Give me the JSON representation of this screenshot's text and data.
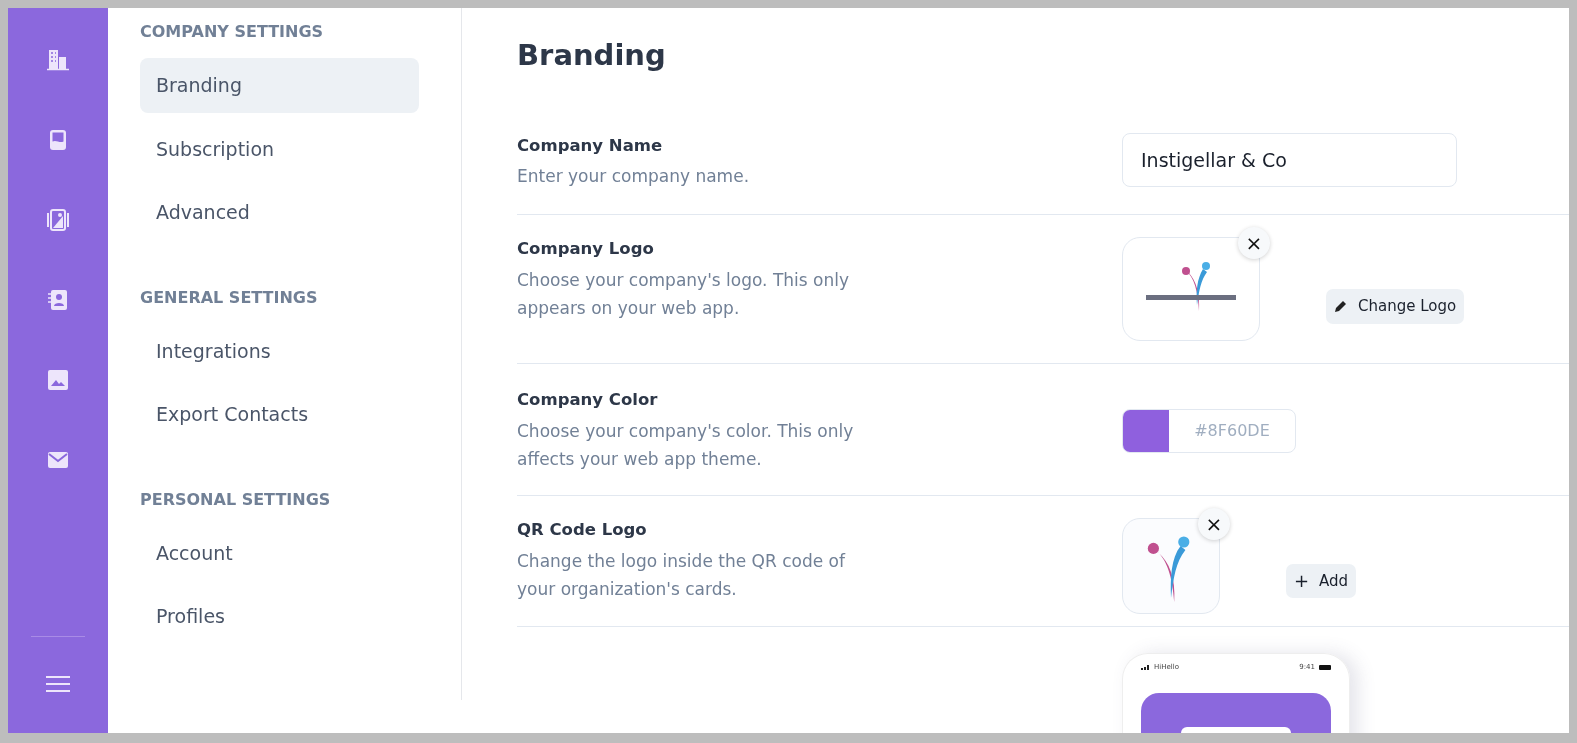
{
  "settings_nav": [
    {
      "title": "COMPANY SETTINGS",
      "items": [
        {
          "label": "Branding",
          "selected": true
        },
        {
          "label": "Subscription",
          "selected": false
        },
        {
          "label": "Advanced",
          "selected": false
        }
      ]
    },
    {
      "title": "GENERAL SETTINGS",
      "items": [
        {
          "label": "Integrations",
          "selected": false
        },
        {
          "label": "Export Contacts",
          "selected": false
        }
      ]
    },
    {
      "title": "PERSONAL SETTINGS",
      "items": [
        {
          "label": "Account",
          "selected": false
        },
        {
          "label": "Profiles",
          "selected": false
        }
      ]
    }
  ],
  "page_title": "Branding",
  "rows": [
    {
      "kind": "text",
      "label": "Company Name",
      "hint": "Enter your company name.",
      "value": "Instigellar & Co"
    },
    {
      "kind": "logo",
      "label": "Company Logo",
      "hint": "Choose your company's logo. This only appears on your web app.",
      "close": "×",
      "button": "Change Logo"
    },
    {
      "kind": "color",
      "label": "Company Color",
      "hint": "Choose your company's color. This only affects your web app theme.",
      "color": "#8f60de",
      "value": "#8F60DE"
    },
    {
      "kind": "qr",
      "label": "QR Code Logo",
      "hint": "Change the logo inside the QR code of your organization's cards.",
      "close": "×",
      "button_icon": "+",
      "button": "Add"
    }
  ],
  "phone_preview": {
    "carrier": "HiHello",
    "time": "9:41"
  }
}
